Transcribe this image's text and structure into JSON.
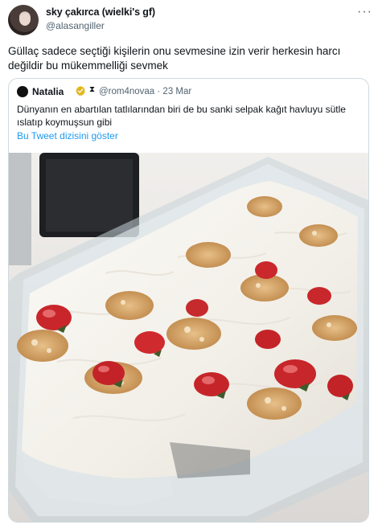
{
  "author": {
    "name": "sky çakırca (wielki's gf)",
    "handle": "@alasangiller"
  },
  "more_icon": "more-options-icon",
  "tweet_text": "Güllaç sadece seçtiği kişilerin onu sevmesine izin verir herkesin harcı değildir bu mükemmelliği sevmek",
  "quote": {
    "name": "Natalia",
    "badge_icon": "gold-verified-icon",
    "hourglass": "⧗",
    "handle_date": "@rom4novaa · 23 Mar",
    "text": "Dünyanın en abartılan tatlılarından biri de bu sanki selpak kağıt havluyu sütle ıslatıp koymuşsun gibi",
    "thread_link": "Bu Tweet dizisini göster",
    "link_color": "#1d9bf0"
  },
  "photo": {
    "subject": "güllaç-dessert-photo"
  }
}
